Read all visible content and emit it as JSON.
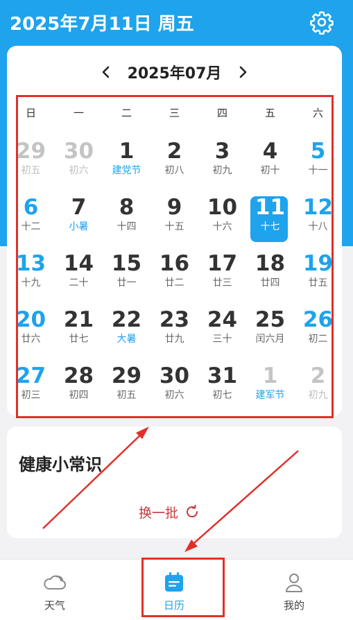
{
  "header": {
    "title": "2025年7月11日 周五",
    "settings_icon": "gear-icon"
  },
  "calendar": {
    "month_label": "2025年07月",
    "prev_icon": "chevron-left-icon",
    "next_icon": "chevron-right-icon",
    "weekdays": [
      "日",
      "一",
      "二",
      "三",
      "四",
      "五",
      "六"
    ],
    "days": [
      {
        "day": "29",
        "sub": "初五",
        "state": "other",
        "festival": false
      },
      {
        "day": "30",
        "sub": "初六",
        "state": "other",
        "festival": false
      },
      {
        "day": "1",
        "sub": "建党节",
        "state": "normal",
        "festival": true
      },
      {
        "day": "2",
        "sub": "初八",
        "state": "normal",
        "festival": false
      },
      {
        "day": "3",
        "sub": "初九",
        "state": "normal",
        "festival": false
      },
      {
        "day": "4",
        "sub": "初十",
        "state": "normal",
        "festival": false
      },
      {
        "day": "5",
        "sub": "十一",
        "state": "weekend",
        "festival": false
      },
      {
        "day": "6",
        "sub": "十二",
        "state": "weekend",
        "festival": false
      },
      {
        "day": "7",
        "sub": "小暑",
        "state": "normal",
        "festival": true
      },
      {
        "day": "8",
        "sub": "十四",
        "state": "normal",
        "festival": false
      },
      {
        "day": "9",
        "sub": "十五",
        "state": "normal",
        "festival": false
      },
      {
        "day": "10",
        "sub": "十六",
        "state": "normal",
        "festival": false
      },
      {
        "day": "11",
        "sub": "十七",
        "state": "today",
        "festival": false
      },
      {
        "day": "12",
        "sub": "十八",
        "state": "weekend",
        "festival": false
      },
      {
        "day": "13",
        "sub": "十九",
        "state": "weekend",
        "festival": false
      },
      {
        "day": "14",
        "sub": "二十",
        "state": "normal",
        "festival": false
      },
      {
        "day": "15",
        "sub": "廿一",
        "state": "normal",
        "festival": false
      },
      {
        "day": "16",
        "sub": "廿二",
        "state": "normal",
        "festival": false
      },
      {
        "day": "17",
        "sub": "廿三",
        "state": "normal",
        "festival": false
      },
      {
        "day": "18",
        "sub": "廿四",
        "state": "normal",
        "festival": false
      },
      {
        "day": "19",
        "sub": "廿五",
        "state": "weekend",
        "festival": false
      },
      {
        "day": "20",
        "sub": "廿六",
        "state": "weekend",
        "festival": false
      },
      {
        "day": "21",
        "sub": "廿七",
        "state": "normal",
        "festival": false
      },
      {
        "day": "22",
        "sub": "大暑",
        "state": "normal",
        "festival": true
      },
      {
        "day": "23",
        "sub": "廿九",
        "state": "normal",
        "festival": false
      },
      {
        "day": "24",
        "sub": "三十",
        "state": "normal",
        "festival": false
      },
      {
        "day": "25",
        "sub": "闰六月",
        "state": "normal",
        "festival": false
      },
      {
        "day": "26",
        "sub": "初二",
        "state": "weekend",
        "festival": false
      },
      {
        "day": "27",
        "sub": "初三",
        "state": "weekend",
        "festival": false
      },
      {
        "day": "28",
        "sub": "初四",
        "state": "normal",
        "festival": false
      },
      {
        "day": "29",
        "sub": "初五",
        "state": "normal",
        "festival": false
      },
      {
        "day": "30",
        "sub": "初六",
        "state": "normal",
        "festival": false
      },
      {
        "day": "31",
        "sub": "初七",
        "state": "normal",
        "festival": false
      },
      {
        "day": "1",
        "sub": "建军节",
        "state": "other",
        "festival": true
      },
      {
        "day": "2",
        "sub": "初九",
        "state": "other",
        "festival": false
      }
    ]
  },
  "tips": {
    "title": "健康小常识",
    "refresh_label": "换一批",
    "refresh_icon": "refresh-icon"
  },
  "bottom_nav": {
    "items": [
      {
        "label": "天气",
        "icon": "cloud-icon",
        "active": false
      },
      {
        "label": "日历",
        "icon": "calendar-icon",
        "active": true
      },
      {
        "label": "我的",
        "icon": "user-icon",
        "active": false
      }
    ]
  },
  "colors": {
    "accent": "#1ea3ec",
    "annotation_red": "#e0302a",
    "refresh_text": "#c8383c"
  }
}
